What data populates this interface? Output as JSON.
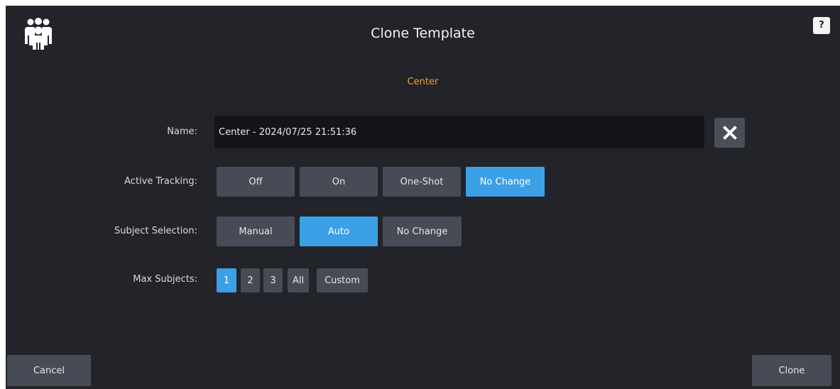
{
  "header": {
    "title": "Clone Template",
    "help_label": "?",
    "logo_icon": "group-people-icon"
  },
  "template_name": "Center",
  "form": {
    "name": {
      "label": "Name:",
      "value": "Center - 2024/07/25 21:51:36",
      "clear_icon": "close-icon"
    },
    "active_tracking": {
      "label": "Active Tracking:",
      "options": [
        "Off",
        "On",
        "One-Shot",
        "No Change"
      ],
      "selected": "No Change"
    },
    "subject_selection": {
      "label": "Subject Selection:",
      "options": [
        "Manual",
        "Auto",
        "No Change"
      ],
      "selected": "Auto"
    },
    "max_subjects": {
      "label": "Max Subjects:",
      "options": [
        "1",
        "2",
        "3",
        "All",
        "Custom"
      ],
      "selected": "1"
    }
  },
  "footer": {
    "cancel_label": "Cancel",
    "clone_label": "Clone"
  },
  "colors": {
    "background": "#222429",
    "button": "#474b55",
    "accent": "#3ca0e6",
    "subtitle": "#f0a23a"
  }
}
